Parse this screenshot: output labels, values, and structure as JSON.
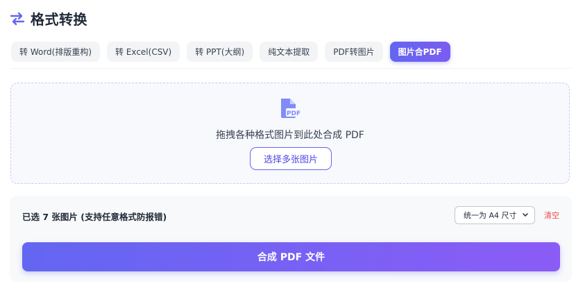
{
  "header": {
    "icon": "swap-arrows-icon",
    "title": "格式转换"
  },
  "tabs": [
    {
      "label": "转 Word(排版重构)",
      "active": false
    },
    {
      "label": "转 Excel(CSV)",
      "active": false
    },
    {
      "label": "转 PPT(大纲)",
      "active": false
    },
    {
      "label": "纯文本提取",
      "active": false
    },
    {
      "label": "PDF转图片",
      "active": false
    },
    {
      "label": "图片合PDF",
      "active": true
    }
  ],
  "dropzone": {
    "icon": "pdf-file-icon",
    "icon_text": "PDF",
    "text": "拖拽各种格式图片到此处合成 PDF",
    "choose_label": "选择多张图片"
  },
  "panel": {
    "selected_text": "已选 7 张图片 (支持任意格式防报错)",
    "size_select_value": "统一为 A4 尺寸",
    "clear_label": "清空",
    "merge_label": "合成 PDF 文件"
  },
  "colors": {
    "accent": "#6366f1",
    "accent_end": "#8b5cf6",
    "danger": "#ef4444"
  }
}
